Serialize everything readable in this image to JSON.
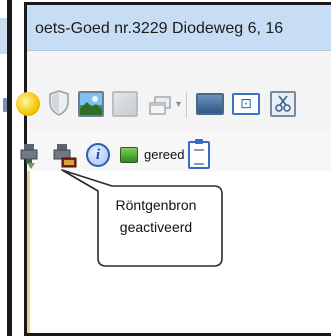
{
  "window": {
    "title": "oets-Goed nr.3229 Diodeweg 6, 16"
  },
  "toolbar_main": {
    "icons": [
      "sun-icon",
      "shield-icon",
      "image-icon",
      "image-disabled-icon",
      "windows-icon",
      "monitor-icon",
      "fit-screen-icon",
      "scissors-image-icon"
    ],
    "fit_glyph": "⊡"
  },
  "toolbar_status": {
    "info_glyph": "i",
    "status_label": "gereed",
    "status_color": "#3c9a2a"
  },
  "tooltip": {
    "line1": "Röntgenbron",
    "line2": "geactiveerd"
  },
  "colors": {
    "titlebar": "#c6ddf4",
    "accent": "#2b5db5"
  }
}
